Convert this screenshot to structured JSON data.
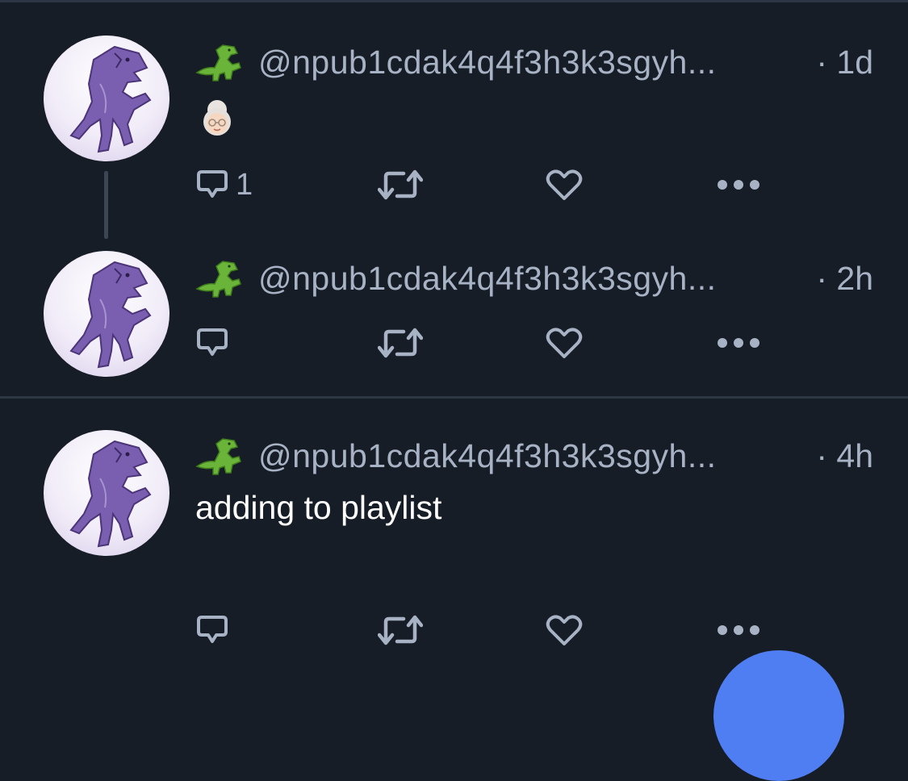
{
  "colors": {
    "background": "#171d27",
    "divider": "#2d3644",
    "muted_text": "#a7b2c4",
    "primary_text": "#ffffff",
    "fab": "#4f7df2"
  },
  "posts": [
    {
      "handle": "@npub1cdak4q4f3h3k3sgyh...",
      "time": "· 1d",
      "body_emoji": "old-woman-emoji",
      "reply_count": "1"
    },
    {
      "handle": "@npub1cdak4q4f3h3k3sgyh...",
      "time": "· 2h",
      "reply_count": ""
    },
    {
      "handle": "@npub1cdak4q4f3h3k3sgyh...",
      "time": "· 4h",
      "text": "adding to playlist",
      "reply_count": ""
    }
  ],
  "icons": [
    "dinosaur-avatar",
    "t-rex-emoji",
    "comment-icon",
    "repost-icon",
    "heart-icon",
    "more-icon"
  ]
}
